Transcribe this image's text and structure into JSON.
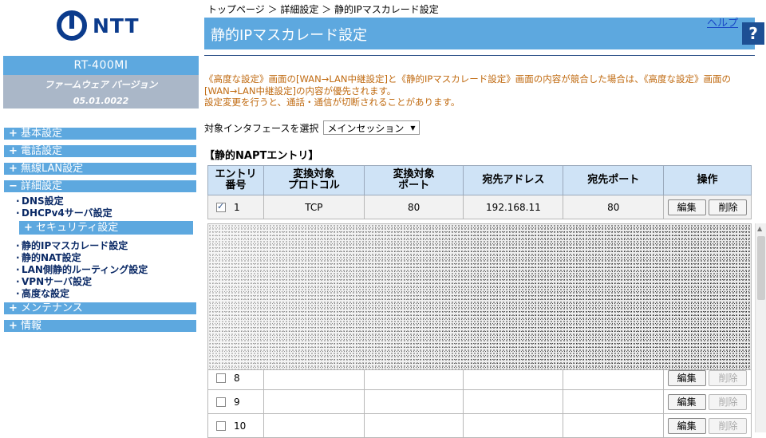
{
  "brand": {
    "logo_text": "NTT"
  },
  "device": {
    "model": "RT-400MI",
    "firmware_label": "ファームウェア バージョン",
    "firmware_version": "05.01.0022"
  },
  "nav": {
    "groups": [
      {
        "sign": "+",
        "label": "基本設定"
      },
      {
        "sign": "+",
        "label": "電話設定"
      },
      {
        "sign": "+",
        "label": "無線LAN設定"
      },
      {
        "sign": "−",
        "label": "詳細設定"
      },
      {
        "sign": "+",
        "label": "メンテナンス"
      },
      {
        "sign": "+",
        "label": "情報"
      }
    ],
    "detail_links_top": [
      "DNS設定",
      "DHCPv4サーバ設定"
    ],
    "security": {
      "sign": "+",
      "label": "セキュリティ設定"
    },
    "detail_links_bottom": [
      "静的IPマスカレード設定",
      "静的NAT設定",
      "LAN側静的ルーティング設定",
      "VPNサーバ設定",
      "高度な設定"
    ]
  },
  "breadcrumb": "トップページ ＞ 詳細設定 ＞ 静的IPマスカレード設定",
  "page_title": "静的IPマスカレード設定",
  "help_label": "ヘルプ",
  "help_button": "?",
  "notice": {
    "line1": "《高度な設定》画面の[WAN→LAN中継設定]と《静的IPマスカレード設定》画面の内容が競合した場合は、《高度な設定》画面の",
    "line2": "[WAN→LAN中継設定]の内容が優先されます。",
    "line3": "設定変更を行うと、通話・通信が切断されることがあります。"
  },
  "interface": {
    "label": "対象インタフェースを選択",
    "selected": "メインセッション"
  },
  "section_title": "【静的NAPTエントリ】",
  "table": {
    "headers": [
      [
        "エントリ",
        "番号"
      ],
      [
        "変換対象",
        "プロトコル"
      ],
      [
        "変換対象",
        "ポート"
      ],
      [
        "宛先アドレス",
        ""
      ],
      [
        "宛先ポート",
        ""
      ],
      [
        "操作",
        ""
      ]
    ],
    "edit_label": "編集",
    "delete_label": "削除",
    "rows": [
      {
        "no": "1",
        "checked": true,
        "protocol": "TCP",
        "port": "80",
        "address": "192.168.11",
        "dport": "80",
        "delete_enabled": true
      },
      {
        "no": "8",
        "checked": false,
        "protocol": "",
        "port": "",
        "address": "",
        "dport": "",
        "delete_enabled": false
      },
      {
        "no": "9",
        "checked": false,
        "protocol": "",
        "port": "",
        "address": "",
        "dport": "",
        "delete_enabled": false
      },
      {
        "no": "10",
        "checked": false,
        "protocol": "",
        "port": "",
        "address": "",
        "dport": "",
        "delete_enabled": false
      }
    ]
  },
  "colors": {
    "accent": "#5da8df",
    "firmware_bg": "#aab7c8",
    "notice": "#c06a10",
    "header_cell": "#cfe3f6",
    "help_button": "#1d4f94"
  }
}
